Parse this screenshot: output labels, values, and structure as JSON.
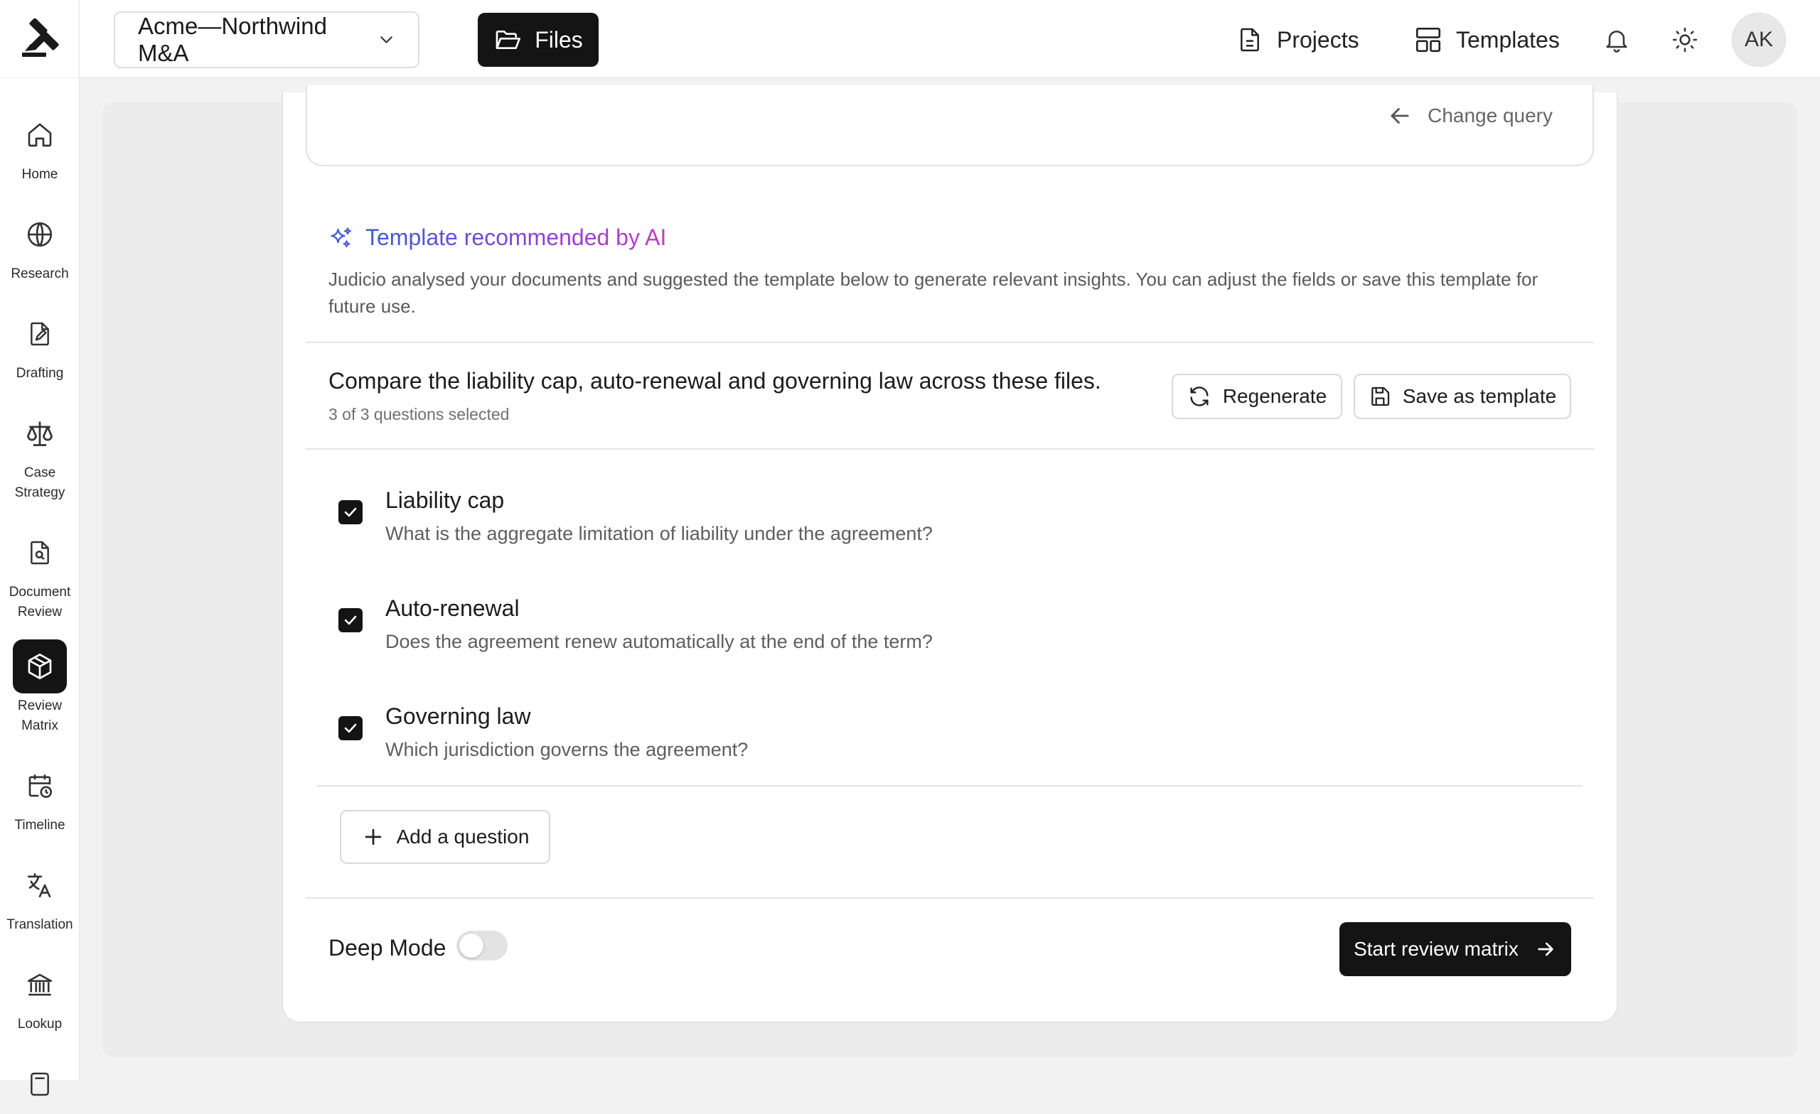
{
  "topbar": {
    "project_name": "Acme—Northwind M&A",
    "files_label": "Files",
    "projects_label": "Projects",
    "templates_label": "Templates",
    "avatar_initials": "AK"
  },
  "sidebar": {
    "items": [
      {
        "label": "Home",
        "icon": "home-icon"
      },
      {
        "label": "Research",
        "icon": "globe-icon"
      },
      {
        "label": "Drafting",
        "icon": "document-pen-icon"
      },
      {
        "label": "Case\nStrategy",
        "icon": "scales-icon"
      },
      {
        "label": "Document\nReview",
        "icon": "document-search-icon"
      },
      {
        "label": "Review\nMatrix",
        "icon": "cube-icon",
        "active": true
      },
      {
        "label": "Timeline",
        "icon": "calendar-clock-icon"
      },
      {
        "label": "Translation",
        "icon": "translate-icon"
      },
      {
        "label": "Lookup",
        "icon": "institution-icon"
      }
    ]
  },
  "query": {
    "change_query_label": "Change query"
  },
  "recommendation": {
    "title": "Template recommended by AI",
    "description": "Judicio analysed your documents and suggested the template below to generate relevant insights. You can adjust the fields or save this template for future use.",
    "query_text": "Compare the liability cap, auto-renewal and governing law across these files.",
    "selected_count": "3 of 3 questions selected",
    "regenerate_label": "Regenerate",
    "save_template_label": "Save as template"
  },
  "questions": [
    {
      "title": "Liability cap",
      "subtitle": "What is the aggregate limitation of liability under the agreement?",
      "checked": true
    },
    {
      "title": "Auto-renewal",
      "subtitle": "Does the agreement renew automatically at the end of the term?",
      "checked": true
    },
    {
      "title": "Governing law",
      "subtitle": "Which jurisdiction governs the agreement?",
      "checked": true
    }
  ],
  "footer": {
    "add_question_label": "Add a question",
    "deep_mode_label": "Deep Mode",
    "deep_mode_on": false,
    "start_label": "Start review matrix"
  },
  "colors": {
    "accent_dark": "#141414",
    "ai_gradient_start": "#3b5bdb",
    "ai_gradient_end": "#c03ac4"
  }
}
